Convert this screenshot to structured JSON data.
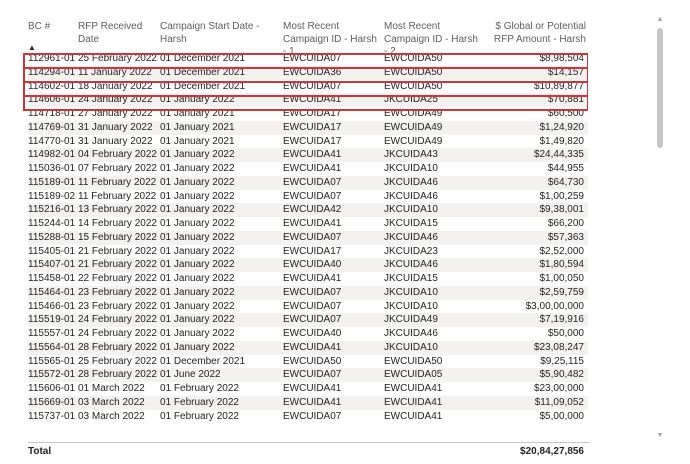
{
  "table": {
    "headers": [
      "BC #",
      "RFP Received Date",
      "Campaign Start Date - Harsh",
      "Most Recent Campaign ID - Harsh - 1",
      "Most Recent Campaign ID - Harsh - 2",
      "$ Global or Potential RFP Amount - Harsh"
    ],
    "sort_indicator": "▲",
    "rows": [
      [
        "112961-01",
        "25 February 2022",
        "01 December 2021",
        "EWCUIDA07",
        "EWCUIDA50",
        "$8,98,504"
      ],
      [
        "114294-01",
        "11 January 2022",
        "01 December 2021",
        "EWCUIDA36",
        "EWCUIDA50",
        "$14,157"
      ],
      [
        "114602-01",
        "18 January 2022",
        "01 December 2021",
        "EWCUIDA07",
        "EWCUIDA50",
        "$10,89,877"
      ],
      [
        "114606-01",
        "24 January 2022",
        "01 January 2022",
        "EWCUIDA41",
        "JKCUIDA25",
        "$70,881"
      ],
      [
        "114718-01",
        "27 January 2022",
        "01 January 2021",
        "EWCUIDA17",
        "EWCUIDA49",
        "$60,500"
      ],
      [
        "114769-01",
        "31 January 2022",
        "01 January 2021",
        "EWCUIDA17",
        "EWCUIDA49",
        "$1,24,920"
      ],
      [
        "114770-01",
        "31 January 2022",
        "01 January 2021",
        "EWCUIDA17",
        "EWCUIDA49",
        "$1,49,820"
      ],
      [
        "114982-01",
        "04 February 2022",
        "01 January 2022",
        "EWCUIDA41",
        "JKCUIDA43",
        "$24,44,335"
      ],
      [
        "115036-01",
        "07 February 2022",
        "01 January 2022",
        "EWCUIDA41",
        "JKCUIDA10",
        "$44,955"
      ],
      [
        "115189-01",
        "11 February 2022",
        "01 January 2022",
        "EWCUIDA07",
        "JKCUIDA46",
        "$64,730"
      ],
      [
        "115189-02",
        "11 February 2022",
        "01 January 2022",
        "EWCUIDA07",
        "JKCUIDA46",
        "$1,00,259"
      ],
      [
        "115216-01",
        "13 February 2022",
        "01 January 2022",
        "EWCUIDA42",
        "JKCUIDA10",
        "$9,38,001"
      ],
      [
        "115244-01",
        "14 February 2022",
        "01 January 2022",
        "EWCUIDA41",
        "JKCUIDA15",
        "$66,200"
      ],
      [
        "115288-01",
        "15 February 2022",
        "01 January 2022",
        "EWCUIDA07",
        "JKCUIDA46",
        "$57,363"
      ],
      [
        "115405-01",
        "21 February 2022",
        "01 January 2022",
        "EWCUIDA17",
        "JKCUIDA23",
        "$2,52,000"
      ],
      [
        "115407-01",
        "21 February 2022",
        "01 January 2022",
        "EWCUIDA40",
        "JKCUIDA46",
        "$1,80,594"
      ],
      [
        "115458-01",
        "22 February 2022",
        "01 January 2022",
        "EWCUIDA41",
        "JKCUIDA15",
        "$1,00,050"
      ],
      [
        "115464-01",
        "23 February 2022",
        "01 January 2022",
        "EWCUIDA07",
        "JKCUIDA10",
        "$2,59,759"
      ],
      [
        "115466-01",
        "23 February 2022",
        "01 January 2022",
        "EWCUIDA07",
        "JKCUIDA10",
        "$3,00,00,000"
      ],
      [
        "115519-01",
        "24 February 2022",
        "01 January 2022",
        "EWCUIDA07",
        "JKCUIDA49",
        "$7,19,916"
      ],
      [
        "115557-01",
        "24 February 2022",
        "01 January 2022",
        "EWCUIDA40",
        "JKCUIDA46",
        "$50,000"
      ],
      [
        "115564-01",
        "28 February 2022",
        "01 January 2022",
        "EWCUIDA41",
        "JKCUIDA10",
        "$23,08,247"
      ],
      [
        "115565-01",
        "25 February 2022",
        "01 December 2021",
        "EWCUIDA50",
        "EWCUIDA50",
        "$9,25,115"
      ],
      [
        "115572-01",
        "28 February 2022",
        "01 June 2022",
        "EWCUIDA07",
        "EWCUIDA05",
        "$5,90,482"
      ],
      [
        "115606-01",
        "01 March 2022",
        "01 February 2022",
        "EWCUIDA41",
        "EWCUIDA41",
        "$23,00,000"
      ],
      [
        "115669-01",
        "03 March 2022",
        "01 February 2022",
        "EWCUIDA41",
        "EWCUIDA41",
        "$11,09,052"
      ],
      [
        "115737-01",
        "03 March 2022",
        "01 February 2022",
        "EWCUIDA07",
        "EWCUIDA41",
        "$5,00,000"
      ]
    ],
    "total_label": "Total",
    "total_value": "$20,84,27,856"
  },
  "scrollbar": {
    "up_icon": "chevron-up-icon",
    "down_icon": "chevron-down-icon"
  },
  "highlight_color": "#d13438"
}
